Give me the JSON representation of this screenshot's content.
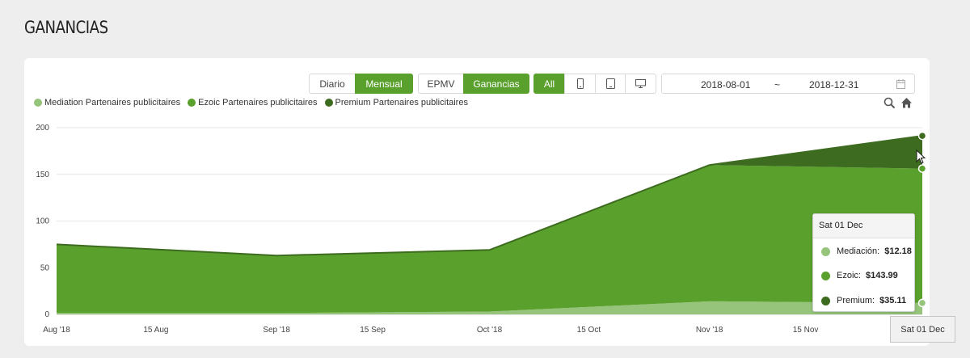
{
  "page": {
    "title": "GANANCIAS"
  },
  "toolbar": {
    "period": {
      "daily": "Diario",
      "monthly": "Mensual"
    },
    "metric": {
      "epmv": "EPMV",
      "earnings": "Ganancias"
    },
    "device": {
      "all": "All",
      "icons": [
        "phone-icon",
        "tablet-icon",
        "desktop-icon"
      ]
    },
    "date_range": {
      "start": "2018-08-01",
      "separator": "~",
      "end": "2018-12-31",
      "icon": "calendar-icon"
    }
  },
  "tools": [
    "zoom-icon",
    "home-icon"
  ],
  "colors": {
    "accent": "#5aa02c",
    "mediation": "#95c47a",
    "ezoic": "#5aa02c",
    "premium": "#3d6b1f"
  },
  "chart_data": {
    "type": "area",
    "stacked": true,
    "x": [
      "2018-08-01",
      "2018-09-01",
      "2018-10-01",
      "2018-11-01",
      "2018-12-01"
    ],
    "x_tick_labels": [
      "Aug '18",
      "15 Aug",
      "Sep '18",
      "15 Sep",
      "Oct '18",
      "15 Oct",
      "Nov '18",
      "15 Nov"
    ],
    "y_ticks": [
      0,
      50,
      100,
      150,
      200
    ],
    "ylim": [
      0,
      200
    ],
    "series": [
      {
        "name": "Mediation Partenaires publicitaires",
        "values": [
          1.5,
          1.5,
          3,
          14,
          12.18
        ]
      },
      {
        "name": "Ezoic Partenaires publicitaires",
        "values": [
          73.5,
          61.5,
          66,
          146,
          143.99
        ]
      },
      {
        "name": "Premium Partenaires publicitaires",
        "values": [
          0,
          0,
          0,
          0,
          35.11
        ]
      }
    ],
    "legend_position": "top-left",
    "grid": true
  },
  "tooltip": {
    "date": "Sat 01 Dec",
    "rows": [
      {
        "label": "Mediación:",
        "value": "$12.18"
      },
      {
        "label": "Ezoic:",
        "value": "$143.99"
      },
      {
        "label": "Premium:",
        "value": "$35.11"
      }
    ]
  },
  "crosshair_label": "Sat 01 Dec"
}
